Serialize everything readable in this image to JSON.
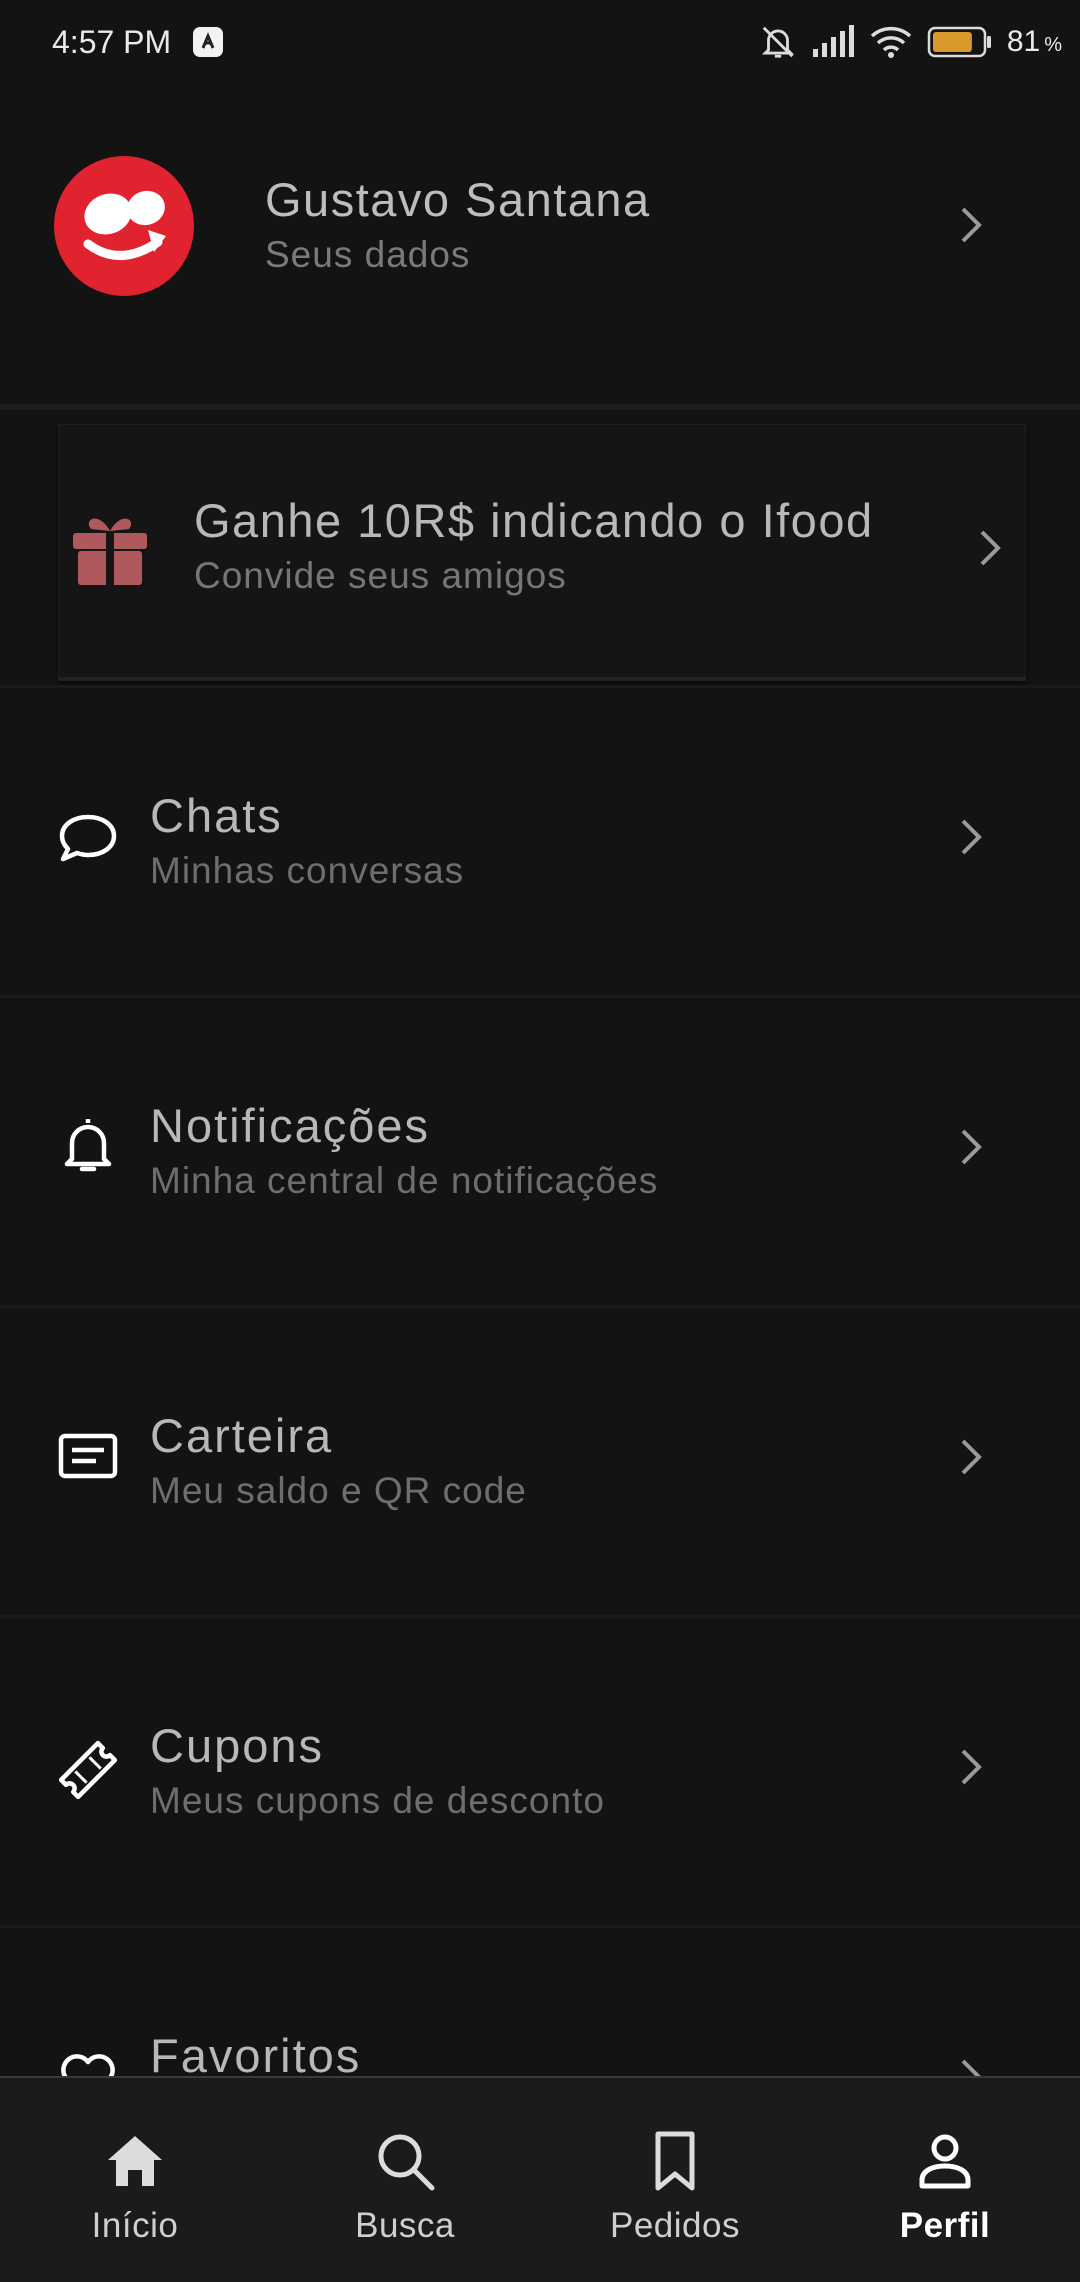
{
  "status_bar": {
    "time": "4:57 PM",
    "battery_level": "81",
    "battery_unit": "%",
    "battery_fill": 0.81,
    "icons": [
      "app-notification-icon",
      "silent-bell-icon",
      "signal-icon",
      "wifi-icon",
      "battery-icon"
    ]
  },
  "profile": {
    "name": "Gustavo Santana",
    "subtitle": "Seus dados",
    "avatar_color": "#e1232f"
  },
  "referral": {
    "title": "Ganhe 10R$ indicando o Ifood",
    "subtitle": "Convide seus amigos",
    "icon": "gift-icon",
    "icon_color": "#b0595d"
  },
  "menu": [
    {
      "title": "Chats",
      "subtitle": "Minhas conversas",
      "icon": "chat-icon"
    },
    {
      "title": "Notificações",
      "subtitle": "Minha central de notificações",
      "icon": "bell-icon"
    },
    {
      "title": "Carteira",
      "subtitle": "Meu saldo e QR code",
      "icon": "wallet-icon"
    },
    {
      "title": "Cupons",
      "subtitle": "Meus cupons de desconto",
      "icon": "ticket-icon"
    },
    {
      "title": "Favoritos",
      "subtitle": "",
      "icon": "heart-icon"
    }
  ],
  "bottom_nav": {
    "items": [
      {
        "label": "Início",
        "icon": "home-icon"
      },
      {
        "label": "Busca",
        "icon": "search-icon"
      },
      {
        "label": "Pedidos",
        "icon": "bookmark-icon"
      },
      {
        "label": "Perfil",
        "icon": "person-icon"
      }
    ],
    "active": "Perfil"
  },
  "colors": {
    "background": "#131313",
    "nav_background": "#1b1b1b",
    "brand_red": "#e1232f"
  }
}
